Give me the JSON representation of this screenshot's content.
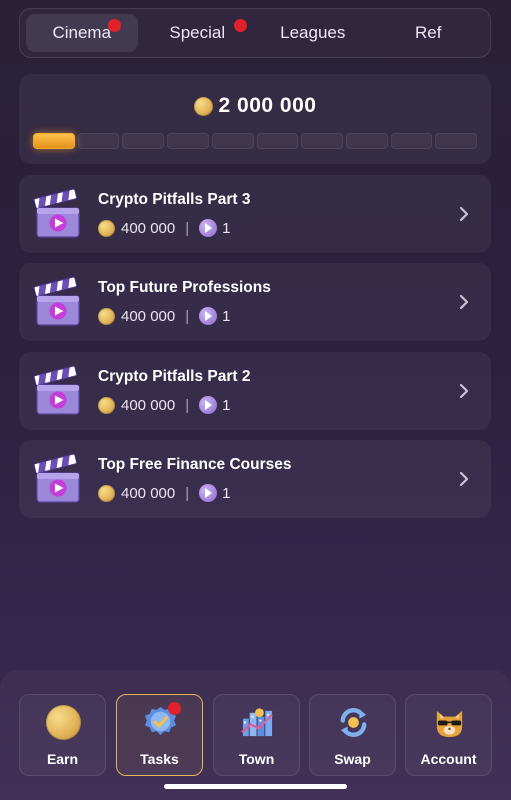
{
  "tabs": [
    {
      "label": "Cinema",
      "active": true,
      "badge": true
    },
    {
      "label": "Special",
      "active": false,
      "badge": true
    },
    {
      "label": "Leagues",
      "active": false,
      "badge": false
    },
    {
      "label": "Ref",
      "active": false,
      "badge": false
    }
  ],
  "balance": {
    "amount": "2 000 000",
    "progress_filled_segments": 1,
    "progress_total_segments": 10
  },
  "tasks": [
    {
      "title": "Crypto Pitfalls Part 3",
      "reward": "400 000",
      "tickets": "1"
    },
    {
      "title": "Top Future Professions",
      "reward": "400 000",
      "tickets": "1"
    },
    {
      "title": "Crypto Pitfalls Part 2",
      "reward": "400 000",
      "tickets": "1"
    },
    {
      "title": "Top Free Finance Courses",
      "reward": "400 000",
      "tickets": "1"
    }
  ],
  "nav": [
    {
      "label": "Earn",
      "icon": "coin-icon",
      "active": false,
      "badge": false
    },
    {
      "label": "Tasks",
      "icon": "check-badge-icon",
      "active": true,
      "badge": true
    },
    {
      "label": "Town",
      "icon": "town-chart-icon",
      "active": false,
      "badge": false
    },
    {
      "label": "Swap",
      "icon": "swap-icon",
      "active": false,
      "badge": false
    },
    {
      "label": "Account",
      "icon": "cat-sunglasses-icon",
      "active": false,
      "badge": false
    }
  ],
  "colors": {
    "accent_orange": "#f4a932",
    "badge_red": "#e0202b",
    "coin_gold": "#e3b55a",
    "ticket_purple": "#8b6bd0",
    "nav_active_border": "#e7b45a"
  }
}
